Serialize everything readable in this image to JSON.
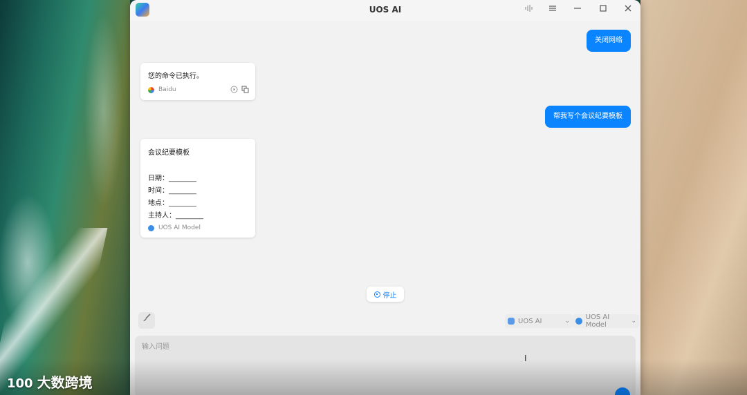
{
  "window": {
    "title": "UOS AI"
  },
  "watermark": {
    "text": "大数跨境",
    "logo": "100"
  },
  "messages": [
    {
      "role": "user",
      "text": "关闭网络"
    },
    {
      "role": "assistant",
      "lines": [
        "您的命令已执行。"
      ],
      "source": "Baidu"
    },
    {
      "role": "user",
      "text": "帮我写个会议纪要模板"
    },
    {
      "role": "assistant",
      "lines": [
        "会议纪要模板",
        "",
        "日期：________",
        "时间：________",
        "地点：________",
        "主持人：________"
      ],
      "source": "UOS AI Model"
    }
  ],
  "stop_button": {
    "label": "停止"
  },
  "toolbar": {
    "assistant_select": "UOS AI",
    "model_select": "UOS AI Model"
  },
  "input": {
    "placeholder": "输入问题"
  },
  "colors": {
    "accent": "#0a84ff"
  },
  "icons": [
    "voice-icon",
    "menu-icon",
    "minimize-icon",
    "maximize-icon",
    "close-icon",
    "play-icon",
    "copy-icon",
    "brush-icon",
    "chevron-down-icon",
    "send-icon"
  ]
}
